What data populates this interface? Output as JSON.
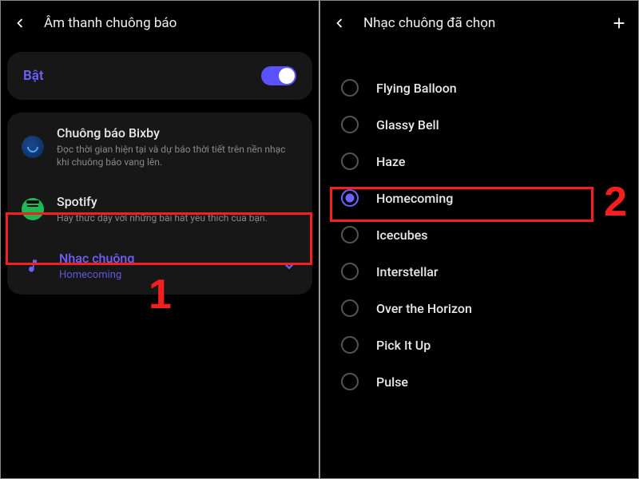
{
  "left": {
    "title": "Âm thanh chuông báo",
    "toggle": {
      "label": "Bật",
      "on": true
    },
    "bixby": {
      "title": "Chuông báo Bixby",
      "sub": "Đọc thời gian hiện tại và dự báo thời tiết trên nền nhạc khi chuông báo vang lên."
    },
    "spotify": {
      "title": "Spotify",
      "sub": "Hãy thức dậy với những bài hát yêu thích của bạn."
    },
    "ringtone": {
      "title": "Nhạc chuông",
      "sub": "Homecoming"
    },
    "step": "1"
  },
  "right": {
    "title": "Nhạc chuông đã chọn",
    "items": [
      {
        "label": "Flying Balloon",
        "selected": false
      },
      {
        "label": "Glassy Bell",
        "selected": false
      },
      {
        "label": "Haze",
        "selected": false
      },
      {
        "label": "Homecoming",
        "selected": true
      },
      {
        "label": "Icecubes",
        "selected": false
      },
      {
        "label": "Interstellar",
        "selected": false
      },
      {
        "label": "Over the Horizon",
        "selected": false
      },
      {
        "label": "Pick It Up",
        "selected": false
      },
      {
        "label": "Pulse",
        "selected": false
      }
    ],
    "step": "2"
  }
}
